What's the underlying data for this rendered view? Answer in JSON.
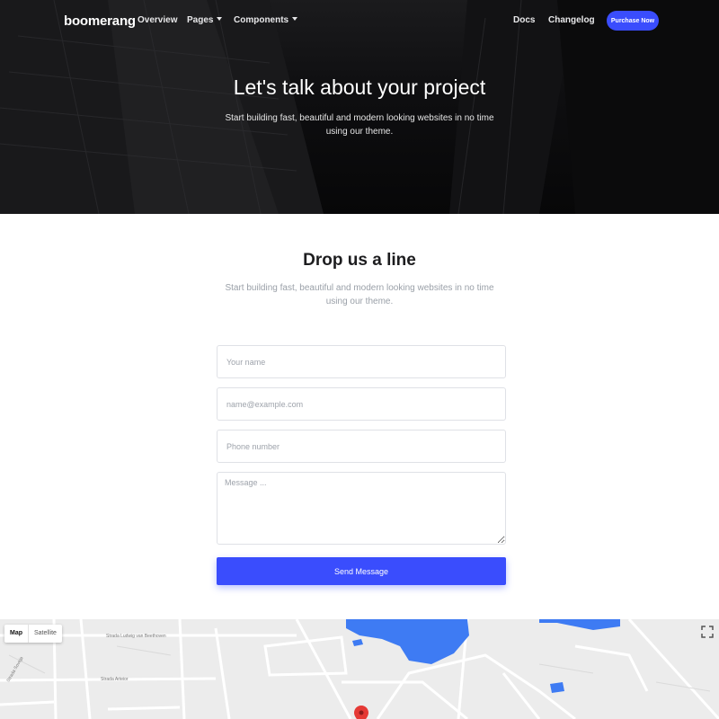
{
  "nav": {
    "logo": "boomerang",
    "links": [
      {
        "label": "Overview"
      },
      {
        "label": "Pages"
      },
      {
        "label": "Components"
      },
      {
        "label": "Docs"
      },
      {
        "label": "Changelog"
      }
    ],
    "purchase_label": "Purchase Now"
  },
  "hero": {
    "title": "Let's talk about your project",
    "subtitle": "Start building fast, beautiful and modern looking websites in no time using our theme."
  },
  "contact": {
    "title": "Drop us a line",
    "subtitle": "Start building fast, beautiful and modern looking websites in no time using our theme.",
    "name_placeholder": "Your name",
    "email_placeholder": "name@example.com",
    "phone_placeholder": "Phone number",
    "message_placeholder": "Message ...",
    "submit_label": "Send Message"
  },
  "map": {
    "map_label": "Map",
    "satellite_label": "Satellite",
    "streets": [
      "Strada Ludwig van Beethoven",
      "Strada Arteior",
      "Strada Soveja"
    ],
    "icons": {
      "fullscreen": "fullscreen-icon",
      "marker": "map-marker-icon"
    }
  },
  "colors": {
    "accent": "#3a4dfd",
    "water": "#3e7bf3",
    "hero_bg": "#0e0e10"
  }
}
